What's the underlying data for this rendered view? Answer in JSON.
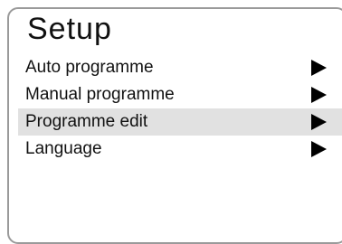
{
  "menu": {
    "title": "Setup",
    "items": [
      {
        "label": "Auto programme",
        "icon": "right-triangle-icon",
        "selected": false
      },
      {
        "label": "Manual programme",
        "icon": "right-triangle-icon",
        "selected": false
      },
      {
        "label": "Programme edit",
        "icon": "right-triangle-icon",
        "selected": true
      },
      {
        "label": "Language",
        "icon": "right-triangle-icon",
        "selected": false
      }
    ]
  },
  "colors": {
    "border": "#9a9a9a",
    "highlight": "#e1e1e1",
    "text": "#111111",
    "arrow": "#000000"
  }
}
